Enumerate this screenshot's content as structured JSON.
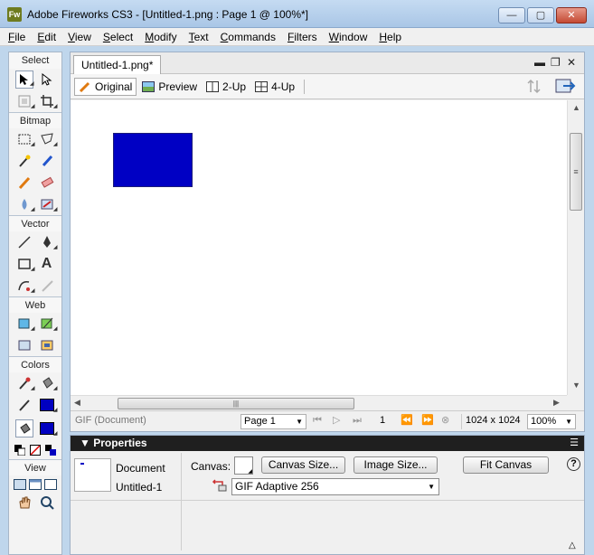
{
  "window": {
    "title": "Adobe Fireworks CS3 - [Untitled-1.png : Page 1 @ 100%*]",
    "app_icon": "Fw",
    "minimize": "—",
    "maximize": "▢",
    "close": "✕"
  },
  "menu": [
    "File",
    "Edit",
    "View",
    "Select",
    "Modify",
    "Text",
    "Commands",
    "Filters",
    "Window",
    "Help"
  ],
  "tools": {
    "select": "Select",
    "bitmap": "Bitmap",
    "vector": "Vector",
    "web": "Web",
    "colors": "Colors",
    "view": "View",
    "text_tool": "A"
  },
  "document": {
    "tab_label": "Untitled-1.png*",
    "views": {
      "original": "Original",
      "preview": "Preview",
      "two_up": "2-Up",
      "four_up": "4-Up"
    },
    "canvas_color": "#ffffff",
    "shape_color": "#0000c4",
    "vthumb_grip": "≡",
    "hthumb_grip": "|||"
  },
  "status": {
    "format": "GIF (Document)",
    "page": "Page 1",
    "frame": "1",
    "size": "1024 x 1024",
    "zoom": "100%"
  },
  "properties": {
    "title": "Properties",
    "doc_label": "Document",
    "doc_name": "Untitled-1",
    "canvas_label": "Canvas:",
    "canvas_size_btn": "Canvas Size...",
    "image_size_btn": "Image Size...",
    "fit_canvas_btn": "Fit Canvas",
    "optimize_select": "GIF Adaptive 256",
    "help": "?"
  },
  "colors": {
    "stroke": "#0000c0",
    "fill": "#0000c0"
  }
}
